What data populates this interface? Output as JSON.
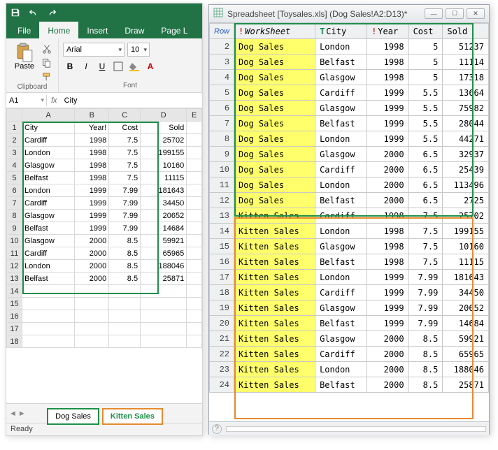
{
  "excel": {
    "tabs": {
      "file": "File",
      "home": "Home",
      "insert": "Insert",
      "draw": "Draw",
      "page": "Page L"
    },
    "ribbon": {
      "paste": "Paste",
      "clipboard_label": "Clipboard",
      "font_name": "Arial",
      "font_size": "10",
      "font_label": "Font"
    },
    "namebox": "A1",
    "fx": "fx",
    "fx_value": "City",
    "columns": [
      "A",
      "B",
      "C",
      "D",
      "E"
    ],
    "headers": {
      "city": "City",
      "year": "Year!",
      "cost": "Cost",
      "sold": "Sold"
    },
    "rows": [
      {
        "n": 2,
        "city": "Cardiff",
        "year": 1998,
        "cost": "7.5",
        "sold": "25702"
      },
      {
        "n": 3,
        "city": "London",
        "year": 1998,
        "cost": "7.5",
        "sold": "199155"
      },
      {
        "n": 4,
        "city": "Glasgow",
        "year": 1998,
        "cost": "7.5",
        "sold": "10160"
      },
      {
        "n": 5,
        "city": "Belfast",
        "year": 1998,
        "cost": "7.5",
        "sold": "11115"
      },
      {
        "n": 6,
        "city": "London",
        "year": 1999,
        "cost": "7.99",
        "sold": "181643"
      },
      {
        "n": 7,
        "city": "Cardiff",
        "year": 1999,
        "cost": "7.99",
        "sold": "34450"
      },
      {
        "n": 8,
        "city": "Glasgow",
        "year": 1999,
        "cost": "7.99",
        "sold": "20652"
      },
      {
        "n": 9,
        "city": "Belfast",
        "year": 1999,
        "cost": "7.99",
        "sold": "14684"
      },
      {
        "n": 10,
        "city": "Glasgow",
        "year": 2000,
        "cost": "8.5",
        "sold": "59921"
      },
      {
        "n": 11,
        "city": "Cardiff",
        "year": 2000,
        "cost": "8.5",
        "sold": "65965"
      },
      {
        "n": 12,
        "city": "London",
        "year": 2000,
        "cost": "8.5",
        "sold": "188046"
      },
      {
        "n": 13,
        "city": "Belfast",
        "year": 2000,
        "cost": "8.5",
        "sold": "25871"
      }
    ],
    "empty_rows": [
      14,
      15,
      16,
      17,
      18
    ],
    "sheet_tabs": {
      "dog": "Dog Sales",
      "kitten": "Kitten Sales"
    },
    "status": "Ready"
  },
  "viewer": {
    "title": "Spreadsheet [Toysales.xls] (Dog Sales!A2:D13)*",
    "columns": {
      "row": "Row",
      "worksheet": "WorkSheet",
      "city": "City",
      "year": "Year",
      "cost": "Cost",
      "sold": "Sold"
    },
    "rows": [
      {
        "n": 2,
        "ws": "Dog Sales",
        "city": "London",
        "year": 1998,
        "cost": "5",
        "sold": "51237",
        "g": "g"
      },
      {
        "n": 3,
        "ws": "Dog Sales",
        "city": "Belfast",
        "year": 1998,
        "cost": "5",
        "sold": "11114",
        "g": "g"
      },
      {
        "n": 4,
        "ws": "Dog Sales",
        "city": "Glasgow",
        "year": 1998,
        "cost": "5",
        "sold": "17318",
        "g": "g"
      },
      {
        "n": 5,
        "ws": "Dog Sales",
        "city": "Cardiff",
        "year": 1999,
        "cost": "5.5",
        "sold": "13664",
        "g": "g"
      },
      {
        "n": 6,
        "ws": "Dog Sales",
        "city": "Glasgow",
        "year": 1999,
        "cost": "5.5",
        "sold": "75982",
        "g": "g"
      },
      {
        "n": 7,
        "ws": "Dog Sales",
        "city": "Belfast",
        "year": 1999,
        "cost": "5.5",
        "sold": "28044",
        "g": "g"
      },
      {
        "n": 8,
        "ws": "Dog Sales",
        "city": "London",
        "year": 1999,
        "cost": "5.5",
        "sold": "44271",
        "g": "g"
      },
      {
        "n": 9,
        "ws": "Dog Sales",
        "city": "Glasgow",
        "year": 2000,
        "cost": "6.5",
        "sold": "32937",
        "g": "g"
      },
      {
        "n": 10,
        "ws": "Dog Sales",
        "city": "Cardiff",
        "year": 2000,
        "cost": "6.5",
        "sold": "25439",
        "g": "g"
      },
      {
        "n": 11,
        "ws": "Dog Sales",
        "city": "London",
        "year": 2000,
        "cost": "6.5",
        "sold": "113496",
        "g": "g"
      },
      {
        "n": 12,
        "ws": "Dog Sales",
        "city": "Belfast",
        "year": 2000,
        "cost": "6.5",
        "sold": "2725",
        "g": "g"
      },
      {
        "n": 13,
        "ws": "Kitten Sales",
        "city": "Cardiff",
        "year": 1998,
        "cost": "7.5",
        "sold": "25702",
        "g": "o"
      },
      {
        "n": 14,
        "ws": "Kitten Sales",
        "city": "London",
        "year": 1998,
        "cost": "7.5",
        "sold": "199155",
        "g": "o"
      },
      {
        "n": 15,
        "ws": "Kitten Sales",
        "city": "Glasgow",
        "year": 1998,
        "cost": "7.5",
        "sold": "10160",
        "g": "o"
      },
      {
        "n": 16,
        "ws": "Kitten Sales",
        "city": "Belfast",
        "year": 1998,
        "cost": "7.5",
        "sold": "11115",
        "g": "o"
      },
      {
        "n": 17,
        "ws": "Kitten Sales",
        "city": "London",
        "year": 1999,
        "cost": "7.99",
        "sold": "181643",
        "g": "o"
      },
      {
        "n": 18,
        "ws": "Kitten Sales",
        "city": "Cardiff",
        "year": 1999,
        "cost": "7.99",
        "sold": "34450",
        "g": "o"
      },
      {
        "n": 19,
        "ws": "Kitten Sales",
        "city": "Glasgow",
        "year": 1999,
        "cost": "7.99",
        "sold": "20652",
        "g": "o"
      },
      {
        "n": 20,
        "ws": "Kitten Sales",
        "city": "Belfast",
        "year": 1999,
        "cost": "7.99",
        "sold": "14684",
        "g": "o"
      },
      {
        "n": 21,
        "ws": "Kitten Sales",
        "city": "Glasgow",
        "year": 2000,
        "cost": "8.5",
        "sold": "59921",
        "g": "o"
      },
      {
        "n": 22,
        "ws": "Kitten Sales",
        "city": "Cardiff",
        "year": 2000,
        "cost": "8.5",
        "sold": "65965",
        "g": "o"
      },
      {
        "n": 23,
        "ws": "Kitten Sales",
        "city": "London",
        "year": 2000,
        "cost": "8.5",
        "sold": "188046",
        "g": "o"
      },
      {
        "n": 24,
        "ws": "Kitten Sales",
        "city": "Belfast",
        "year": 2000,
        "cost": "8.5",
        "sold": "25871",
        "g": "o"
      }
    ],
    "help": "?"
  }
}
